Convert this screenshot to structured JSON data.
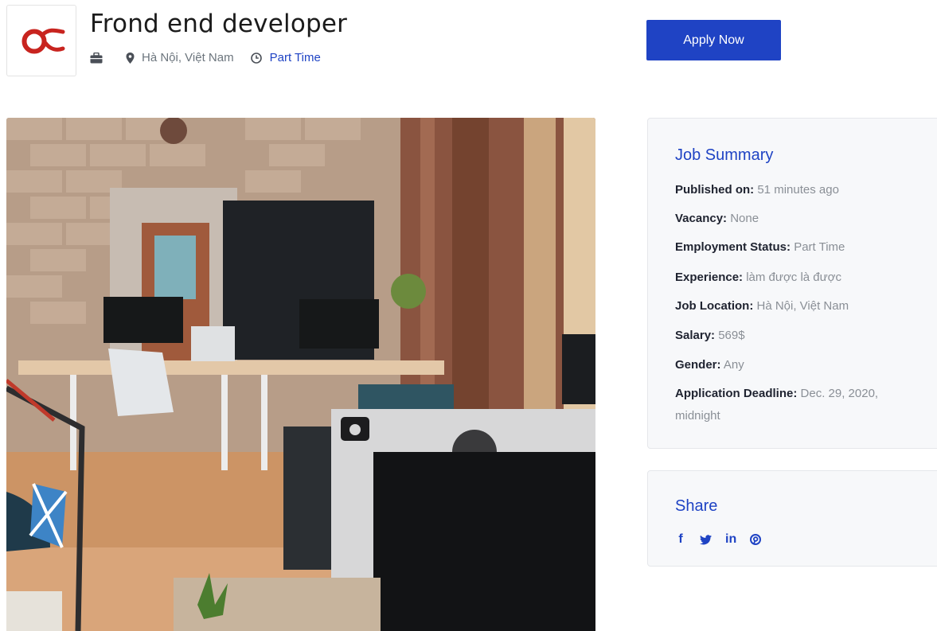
{
  "job": {
    "title": "Frond end developer",
    "location": "Hà Nội, Việt Nam",
    "employment_type": "Part Time"
  },
  "actions": {
    "apply_label": "Apply Now"
  },
  "icons": {
    "briefcase": "briefcase-icon",
    "location": "map-pin-icon",
    "clock": "clock-icon"
  },
  "summary": {
    "title": "Job Summary",
    "rows": [
      {
        "label": "Published on:",
        "value": "51 minutes ago"
      },
      {
        "label": "Vacancy:",
        "value": "None"
      },
      {
        "label": "Employment Status:",
        "value": "Part Time"
      },
      {
        "label": "Experience:",
        "value": "làm được là được"
      },
      {
        "label": "Job Location:",
        "value": "Hà Nội, Việt Nam"
      },
      {
        "label": "Salary:",
        "value": "569$"
      },
      {
        "label": "Gender:",
        "value": "Any"
      },
      {
        "label": "Application Deadline:",
        "value": "Dec. 29, 2020, midnight"
      }
    ]
  },
  "share": {
    "title": "Share",
    "links": [
      {
        "icon": "facebook-icon",
        "glyph": "f"
      },
      {
        "icon": "twitter-icon",
        "glyph": ""
      },
      {
        "icon": "linkedin-icon",
        "glyph": "in"
      },
      {
        "icon": "pinterest-icon",
        "glyph": ""
      }
    ]
  },
  "colors": {
    "accent": "#1f43c4",
    "logo": "#c8241f",
    "muted": "#8a8f96"
  }
}
